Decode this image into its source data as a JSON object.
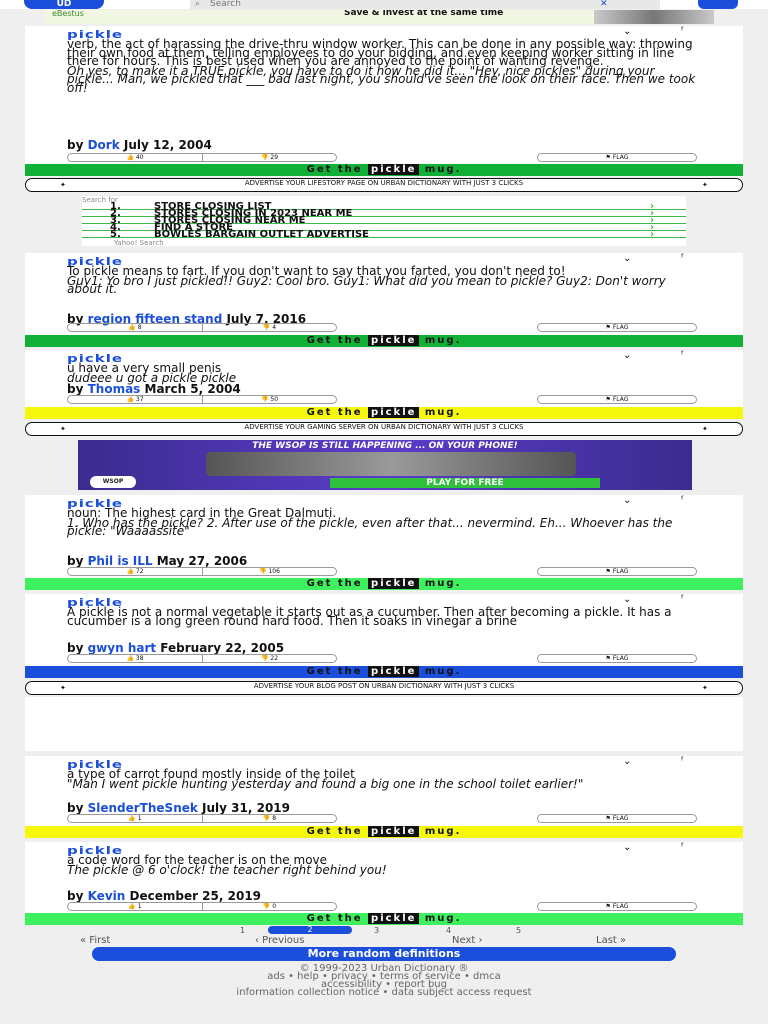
{
  "header": {
    "logo": "UD",
    "search_placeholder": "Search",
    "close_glyph": "✕"
  },
  "top_ad": {
    "left": "eBestus",
    "right": "Save & invest at the same time"
  },
  "cards": [
    {
      "word": "pickle",
      "body": [
        "verb, the act of harassing the drive-thru window worker. This can be done in any possible way: throwing their own food at them, telling employees to do your bidding, and even keeping worker sitting in line there for hours. This is best used when you are annoyed to the point of wanting revenge."
      ],
      "example": "Oh yes, to make it a TRUE pickle, you have to do it how he did it... \"Hey, nice pickles\" during your pickle... Man, we pickled that ___ bad last night, you should've seen the look on their face. Then we took off!",
      "author": "Dork",
      "date": "July 12, 2004",
      "up": "40",
      "down": "29",
      "flag": "FLAG",
      "mug_pre": "Get the",
      "mug_word": "pickle",
      "mug_post": "mug."
    },
    {
      "word": "pickle",
      "body": [
        "To pickle means to fart. If you don't want to say that you farted, you don't need to!"
      ],
      "example": "Guy1: Yo bro I just pickled!! Guy2: Cool bro. Guy1: What did you mean to pickle? Guy2: Don't worry about it.",
      "author": "region fifteen stand",
      "date": "July 7, 2016",
      "up": "8",
      "down": "4",
      "flag": "FLAG",
      "mug_pre": "Get the",
      "mug_word": "pickle",
      "mug_post": "mug."
    },
    {
      "word": "pickle",
      "body": [
        "u have a very small penis"
      ],
      "example": "dudeee u got a pickle pickle",
      "author": "Thomas",
      "date": "March 5, 2004",
      "up": "37",
      "down": "50",
      "flag": "FLAG",
      "mug_pre": "Get the",
      "mug_word": "pickle",
      "mug_post": "mug."
    },
    {
      "word": "pickle",
      "body": [
        "noun: The highest card in the Great Dalmuti."
      ],
      "example": "1. Who has the pickle? 2. After use of the pickle, even after that... nevermind. Eh... Whoever has the pickle: \"Waaaassite\"",
      "author": "Phil is ILL",
      "date": "May 27, 2006",
      "up": "72",
      "down": "106",
      "flag": "FLAG",
      "mug_pre": "Get the",
      "mug_word": "pickle",
      "mug_post": "mug."
    },
    {
      "word": "pickle",
      "body": [
        "A pickle is not a normal vegetable it starts out as a cucumber. Then after becoming a pickle. It has a cucumber is a long green round hard food. Then it soaks in vinegar a brine"
      ],
      "example": "",
      "author": "gwyn hart",
      "date": "February 22, 2005",
      "up": "38",
      "down": "22",
      "flag": "FLAG",
      "mug_pre": "Get the",
      "mug_word": "pickle",
      "mug_post": "mug."
    },
    {
      "word": "pickle",
      "body": [
        "a type of carrot found mostly inside of the toilet"
      ],
      "example": "\"Man I went pickle hunting yesterday and found a big one in the school toilet earlier!\"",
      "author": "SlenderTheSnek",
      "date": "July 31, 2019",
      "up": "1",
      "down": "8",
      "flag": "FLAG",
      "mug_pre": "Get the",
      "mug_word": "pickle",
      "mug_post": "mug."
    },
    {
      "word": "pickle",
      "body": [
        "a code word for the teacher is on the move"
      ],
      "example": "The pickle @ 6 o'clock! the teacher right behind you!",
      "author": "Kevin",
      "date": "December 25, 2019",
      "up": "1",
      "down": "0",
      "flag": "FLAG",
      "mug_pre": "Get the",
      "mug_word": "pickle",
      "mug_post": "mug."
    }
  ],
  "banners": [
    {
      "text": "ADVERTISE YOUR LIFESTORY PAGE ON URBAN DICTIONARY WITH JUST 3 CLICKS"
    },
    {
      "text": "ADVERTISE YOUR GAMING SERVER ON URBAN DICTIONARY WITH JUST 3 CLICKS"
    },
    {
      "text": "ADVERTISE YOUR BLOG POST ON URBAN DICTIONARY WITH JUST 3 CLICKS"
    }
  ],
  "yahoo": {
    "label": "Search for",
    "rows": [
      {
        "n": "1.",
        "t": "STORE CLOSING LIST"
      },
      {
        "n": "2.",
        "t": "STORES CLOSING IN 2023 NEAR ME"
      },
      {
        "n": "3.",
        "t": "STORES CLOSING NEAR ME"
      },
      {
        "n": "4.",
        "t": "FIND A STORE"
      },
      {
        "n": "5.",
        "t": "BOWLES BARGAIN OUTLET ADVERTISE"
      }
    ],
    "footer": "Yahoo! Search"
  },
  "wsop": {
    "headline": "THE WSOP IS STILL HAPPENING ... ON YOUR PHONE!",
    "cta": "PLAY FOR FREE",
    "logo": "WSOP"
  },
  "pager": {
    "pages": [
      "1",
      "2",
      "3",
      "4",
      "5"
    ],
    "first": "« First",
    "previous": "‹ Previous",
    "next": "Next ›",
    "last": "Last »",
    "more": "More random definitions"
  },
  "footer": {
    "line1": "© 1999-2023 Urban Dictionary ®",
    "line2": "ads • help • privacy • terms of service • dmca",
    "line3": "accessibility • report bug",
    "line4": "information collection notice • data subject access request"
  }
}
